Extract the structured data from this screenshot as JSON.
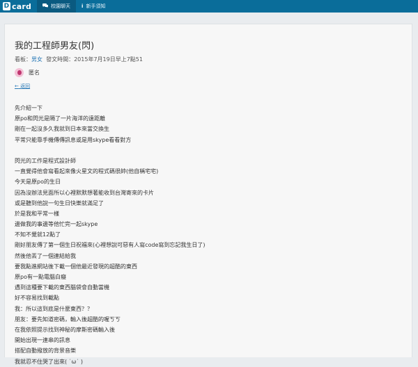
{
  "nav": {
    "logo_text": "card",
    "tabs": [
      {
        "icon": "chat-icon",
        "label": "校園聊天",
        "active": true
      },
      {
        "icon": "info-icon",
        "label": "新手須知",
        "active": false
      }
    ]
  },
  "post": {
    "title": "我的工程師男友(閃)",
    "board_label": "看板：",
    "board": "男女",
    "time_label": "發文時間：",
    "time": "2015年7月19日早上7點51",
    "author": "匿名",
    "back_label": "返回",
    "paragraphs": [
      [
        "先介紹一下",
        "原po和閃光是隔了一片海洋的遠距離",
        "剛在一起沒多久我就到日本來當交換生",
        "平常只能靠手機傳傳訊息或是用skype看看對方"
      ],
      [
        "閃光的工作是程式設計師",
        "一直覺得他會寫看起來像火星文的程式碼很帥(他自稱宅宅)",
        "今天是原po的生日",
        "因為沒辦法見面所以心裡默默想著能收到台灣寄來的卡片",
        "或是聽到他說一句生日快樂就滿足了",
        "於是我和平常一樣",
        "邊做我的事邊等他忙完一起skype",
        "不知不覺就12點了",
        "剛好朋友傳了第一個生日祝福來(心裡想說可惡有人寫code寫到忘記我生日了)",
        "然後他丟了一個連結給我",
        "要我點進網站後下載一個他最近發現的超酷的東西",
        "原po有一點電腦白癡",
        "遇到這種要下載的東西腦袋會自動當機",
        "好不容易找到載點",
        "我：所以這到底是什麼東西？？",
        "朋友：要先知道密碼，輸入後超酷的喔ㄎㄎ",
        "在我依照提示找到神秘的摩斯密碼輸入後",
        "開始出現一連串的訊息",
        "搭配自動撥放的背景音樂",
        "我就忍不住哭了出來( ˙ω˙ )"
      ]
    ]
  }
}
